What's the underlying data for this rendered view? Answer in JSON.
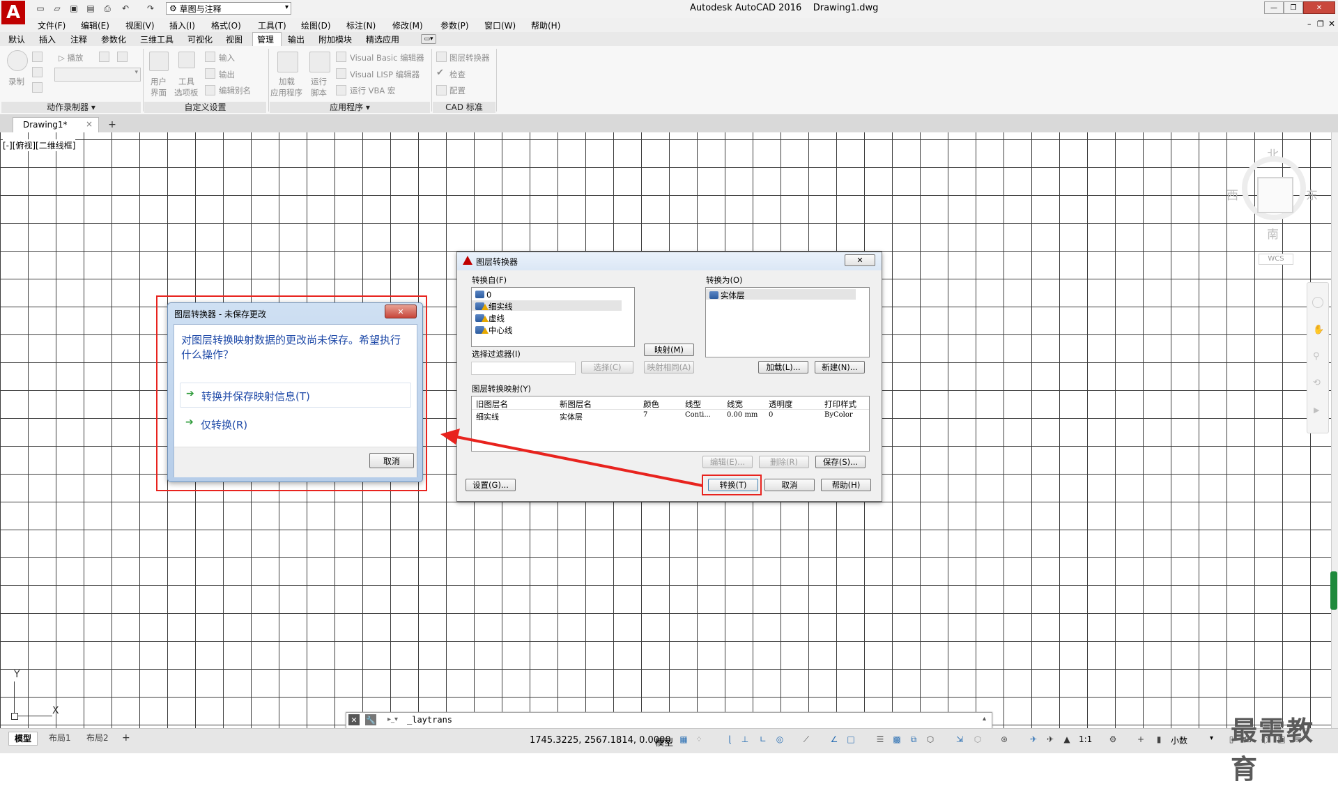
{
  "window": {
    "title": "Autodesk AutoCAD 2016    Drawing1.dwg",
    "workspace": "草图与注释"
  },
  "menu": [
    "文件(F)",
    "编辑(E)",
    "视图(V)",
    "插入(I)",
    "格式(O)",
    "工具(T)",
    "绘图(D)",
    "标注(N)",
    "修改(M)",
    "参数(P)",
    "窗口(W)",
    "帮助(H)"
  ],
  "ribbon_tabs": [
    "默认",
    "插入",
    "注释",
    "参数化",
    "三维工具",
    "可视化",
    "视图",
    "管理",
    "输出",
    "附加模块",
    "精选应用"
  ],
  "ribbon_active_tab": "管理",
  "ribbon": {
    "action_recorder": {
      "title": "动作录制器",
      "record": "录制",
      "play": "播放"
    },
    "customize": {
      "title": "自定义设置",
      "user_interface_1": "用户",
      "user_interface_2": "界面",
      "tool_palettes_1": "工具",
      "tool_palettes_2": "选项板",
      "import": "输入",
      "export": "输出",
      "edit_aliases": "编辑别名"
    },
    "applications": {
      "title": "应用程序",
      "load_1": "加载",
      "load_2": "应用程序",
      "run_script_1": "运行",
      "run_script_2": "脚本",
      "vba_editor": "Visual Basic 编辑器",
      "lisp_editor": "Visual LISP 编辑器",
      "run_vba": "运行 VBA 宏"
    },
    "cad_standards": {
      "title": "CAD 标准",
      "layer_translator": "图层转换器",
      "check": "检查",
      "configure": "配置"
    }
  },
  "file_tab": "Drawing1*",
  "viewport_label": "[-][俯视][二维线框]",
  "viewcube": {
    "north": "北",
    "south": "南",
    "east": "东",
    "west": "西",
    "wcs": "WCS"
  },
  "ucs": {
    "x": "X",
    "y": "Y"
  },
  "command_line": {
    "text": "_laytrans"
  },
  "layout_tabs": [
    "模型",
    "布局1",
    "布局2"
  ],
  "status": {
    "coordinates": "1745.3225, 2567.1814, 0.0000",
    "model": "模型",
    "scale": "1:1",
    "units": "小数"
  },
  "watermark": "最需教育",
  "translator_dialog": {
    "title": "图层转换器",
    "translate_from_label": "转换自(F)",
    "from_layers": [
      "0",
      "细实线",
      "虚线",
      "中心线"
    ],
    "from_selected": "细实线",
    "translate_to_label": "转换为(O)",
    "to_layers": [
      "实体层"
    ],
    "map_btn": "映射(M)",
    "map_same_btn": "映射相同(A)",
    "filter_label": "选择过滤器(I)",
    "select_btn": "选择(C)",
    "load_btn": "加载(L)...",
    "new_btn": "新建(N)...",
    "mappings_label": "图层转换映射(Y)",
    "columns": [
      "旧图层名",
      "新图层名",
      "颜色",
      "线型",
      "线宽",
      "透明度",
      "打印样式"
    ],
    "rows": [
      [
        "细实线",
        "实体层",
        "7",
        "Conti...",
        "0.00 mm",
        "0",
        "ByColor"
      ]
    ],
    "edit_btn": "编辑(E)...",
    "remove_btn": "删除(R)",
    "save_btn": "保存(S)...",
    "settings_btn": "设置(G)...",
    "translate_btn": "转换(T)",
    "cancel_btn": "取消",
    "help_btn": "帮助(H)"
  },
  "unsaved_dialog": {
    "title": "图层转换器 - 未保存更改",
    "message": "对图层转换映射数据的更改尚未保存。希望执行什么操作？",
    "option1": "转换并保存映射信息(T)",
    "option2": "仅转换(R)",
    "cancel": "取消"
  },
  "colors": {
    "annotation_red": "#e8231e",
    "link_blue": "#1f4aa8",
    "arrow_green": "#2e9b3a"
  }
}
